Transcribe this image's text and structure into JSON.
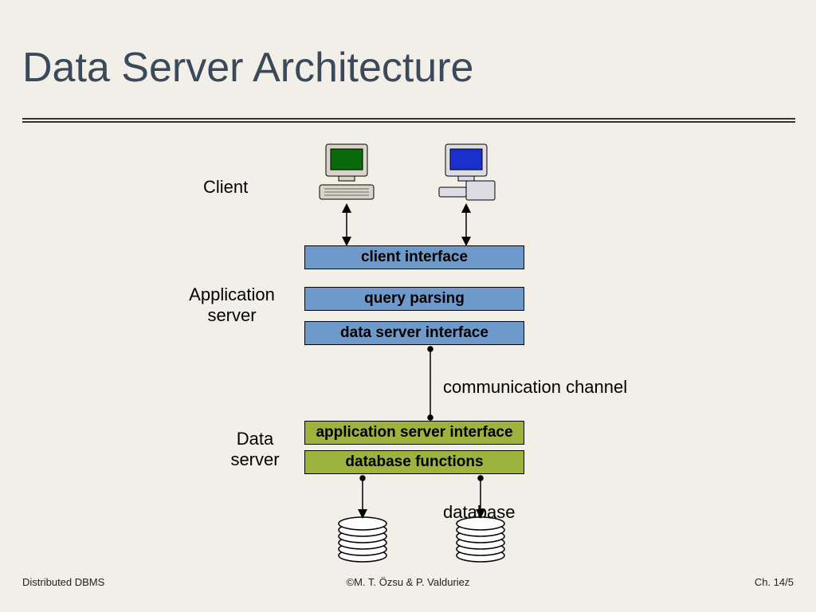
{
  "title": "Data Server Architecture",
  "labels": {
    "client": "Client",
    "app_server": "Application\nserver",
    "comm_channel": "communication channel",
    "data_server": "Data\nserver",
    "database": "database"
  },
  "boxes": {
    "client_interface": "client interface",
    "query_parsing": "query parsing",
    "data_server_interface": "data server interface",
    "app_server_interface": "application server interface",
    "db_functions": "database functions"
  },
  "footer": {
    "left": "Distributed DBMS",
    "center": "©M. T. Özsu & P. Valduriez",
    "right": "Ch. 14/5"
  },
  "colors": {
    "box_blue": "#6e9acb",
    "box_olive": "#9eb23e",
    "bg": "#f2efe8"
  }
}
